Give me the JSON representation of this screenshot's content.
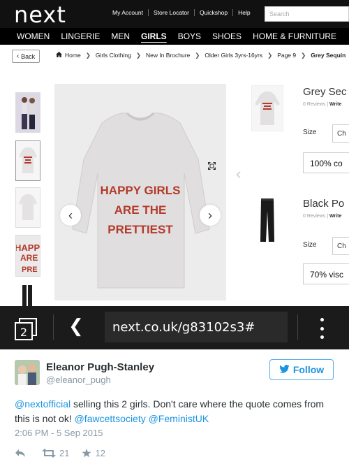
{
  "site": {
    "logo": "next",
    "util_links": [
      "My Account",
      "Store Locator",
      "Quickshop",
      "Help"
    ],
    "search_placeholder": "Search",
    "nav": [
      "WOMEN",
      "LINGERIE",
      "MEN",
      "GIRLS",
      "BOYS",
      "SHOES",
      "HOME & FURNITURE"
    ],
    "active_nav": "GIRLS"
  },
  "breadcrumb": {
    "back_label": "Back",
    "items": [
      "Home",
      "Girls Clothing",
      "New In Brochure",
      "Older Girls 3yrs-16yrs",
      "Page 9",
      "Grey Sequin"
    ]
  },
  "product": {
    "print_text": [
      "HAPPY GIRLS",
      "ARE THE",
      "PRETTIEST"
    ],
    "thumb_print_text": "HAPPY ARE",
    "related": [
      {
        "title": "Grey Sec",
        "reviews": "0 Reviews",
        "write": "Write",
        "size_label": "Size",
        "size_value": "Ch",
        "composition": "100% co"
      },
      {
        "title": "Black Po",
        "reviews": "0 Reviews",
        "write": "Write",
        "size_label": "Size",
        "size_value": "Ch",
        "composition": "70% visc"
      }
    ]
  },
  "browser": {
    "tab_count": "2",
    "url": "next.co.uk/g83102s3#"
  },
  "tweet": {
    "name": "Eleanor Pugh-Stanley",
    "handle": "@eleanor_pugh",
    "follow_label": "Follow",
    "text_parts": [
      {
        "t": "@nextofficial",
        "link": true
      },
      {
        "t": " selling this 2 girls. Don't care where the quote comes from this is not ok! ",
        "link": false
      },
      {
        "t": "@fawcettsociety",
        "link": true
      },
      {
        "t": " ",
        "link": false
      },
      {
        "t": "@FeministUK",
        "link": true
      }
    ],
    "timestamp": "2:06 PM - 5 Sep 2015",
    "retweets": "21",
    "likes": "12"
  },
  "colors": {
    "twitter_blue": "#1b95e0",
    "header_black": "#111111",
    "sequin_red": "#b33a2b"
  }
}
